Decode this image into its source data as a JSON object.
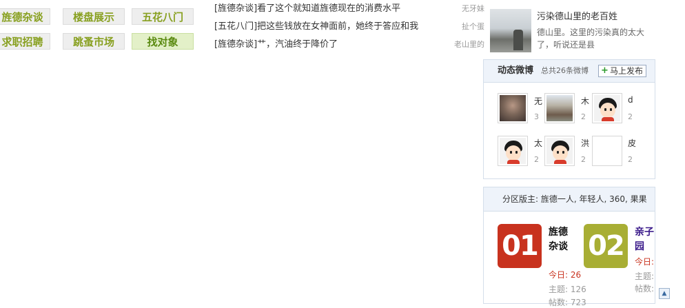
{
  "nav": {
    "items": [
      {
        "label": "旌德杂谈",
        "style": "grey"
      },
      {
        "label": "楼盘展示",
        "style": "grey"
      },
      {
        "label": "五花八门",
        "style": "grey"
      },
      {
        "label": "求职招聘",
        "style": "grey"
      },
      {
        "label": "跳蚤市场",
        "style": "grey"
      },
      {
        "label": "找对象",
        "style": "green"
      }
    ]
  },
  "threads": [
    {
      "title": "[旌德杂谈]看了这个就知道旌德现在的消费水平",
      "author": "无牙妹"
    },
    {
      "title": "[五花八门]把这些钱放在女神面前，她终于答应和我",
      "author": "扯个蛋"
    },
    {
      "title": "[旌德杂谈]艹，汽油终于降价了",
      "author": "老山里的"
    }
  ],
  "news": {
    "title": "污染德山里的老百姓",
    "desc": "德山里。这里的污染真的太大了，听说还是县"
  },
  "weibo": {
    "title": "动态微博",
    "count": "总共26条微博",
    "publish_label": "马上发布",
    "users": [
      {
        "name": "无",
        "num": "3",
        "avatar": "photo1"
      },
      {
        "name": "木",
        "num": "2",
        "avatar": "photo2"
      },
      {
        "name": "d",
        "num": "2",
        "avatar": "cartoon"
      },
      {
        "name": "太",
        "num": "2",
        "avatar": "cartoon"
      },
      {
        "name": "洪",
        "num": "2",
        "avatar": "cartoon"
      },
      {
        "name": "皮",
        "num": "2",
        "avatar": "blank"
      }
    ]
  },
  "moderators": {
    "label": "分区版主: 旌德一人, 年轻人, 360, 果果",
    "forums": [
      {
        "rank": "01",
        "name": "旌德杂谈",
        "today_label": "今日:",
        "today": "26",
        "topics_label": "主题:",
        "topics": "126",
        "posts_label": "帖数:",
        "posts": "723",
        "badge_color": "#c8321e",
        "name_color": "#111111"
      },
      {
        "rank": "02",
        "name": "亲子园",
        "today_label": "今日:",
        "today": "",
        "topics_label": "主题:",
        "topics": "",
        "posts_label": "帖数:",
        "posts": "",
        "badge_color": "#a8ae34",
        "name_color": "#3a1a8a"
      }
    ]
  },
  "colors": {
    "today_value": "#c8321e",
    "stat_label": "#999999"
  }
}
